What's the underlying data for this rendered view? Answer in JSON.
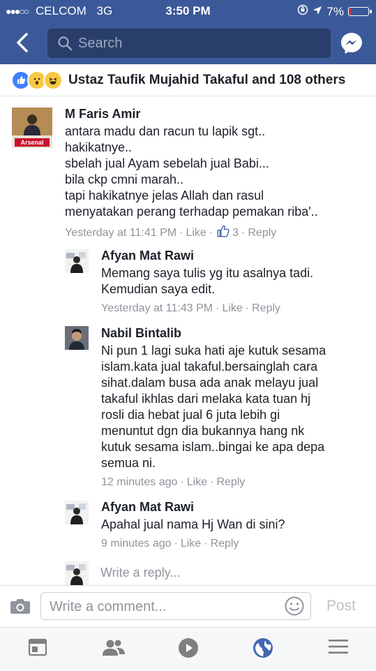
{
  "status_bar": {
    "signal": "●●●○○",
    "carrier": "CELCOM",
    "network": "3G",
    "time": "3:50 PM",
    "battery": "7%",
    "battery_level": 0.07,
    "battery_color": "#e0322b"
  },
  "nav": {
    "search_placeholder": "Search",
    "back_icon": "back-chevron-icon",
    "messenger_icon": "messenger-icon"
  },
  "reactions": {
    "summary": "Ustaz Taufik Mujahid Takaful and 108 others",
    "icons": [
      "like-icon",
      "wow-icon",
      "haha-icon"
    ]
  },
  "comments": [
    {
      "name": "M Faris Amir",
      "text": "antara madu dan racun tu lapik sgt..\nhakikatnye..\nsbelah jual Ayam sebelah jual Babi...\nbila ckp cmni marah..\ntapi hakikatnye jelas Allah dan rasul\nmenyatakan perang terhadap pemakan riba'..",
      "time": "Yesterday at 11:41 PM",
      "like": "Like",
      "like_count": "3",
      "reply": "Reply",
      "avatar_label": "Arsenal"
    },
    {
      "name": "Afyan Mat Rawi",
      "text": "Memang saya tulis yg itu asalnya tadi.\nKemudian saya edit.",
      "time": "Yesterday at 11:43 PM",
      "like": "Like",
      "reply": "Reply"
    },
    {
      "name": "Nabil Bintalib",
      "text": "Ni pun 1 lagi suka hati aje kutuk sesama\nislam.kata jual takaful.bersainglah cara\nsihat.dalam busa ada anak melayu jual\ntakaful ikhlas dari melaka kata tuan hj\nrosli dia hebat jual 6 juta lebih gi\nmenuntut dgn dia bukannya hang nk\nkutuk sesama islam..bingai ke apa depa\nsemua ni.",
      "time": "12 minutes ago",
      "like": "Like",
      "reply": "Reply"
    },
    {
      "name": "Afyan Mat Rawi",
      "text": "Apahal jual nama Hj Wan di sini?",
      "time": "9 minutes ago",
      "like": "Like",
      "reply": "Reply"
    }
  ],
  "reply_box": {
    "placeholder": "Write a reply..."
  },
  "composer": {
    "placeholder": "Write a comment...",
    "post_label": "Post"
  },
  "tab_bar": {
    "icons": [
      "news-feed-icon",
      "friends-icon",
      "video-icon",
      "globe-notifications-icon",
      "menu-icon"
    ]
  },
  "colors": {
    "brand_blue": "#3b5998",
    "search_bg": "#293e6a",
    "meta_gray": "#90949c",
    "active_tab": "#4267b2"
  }
}
